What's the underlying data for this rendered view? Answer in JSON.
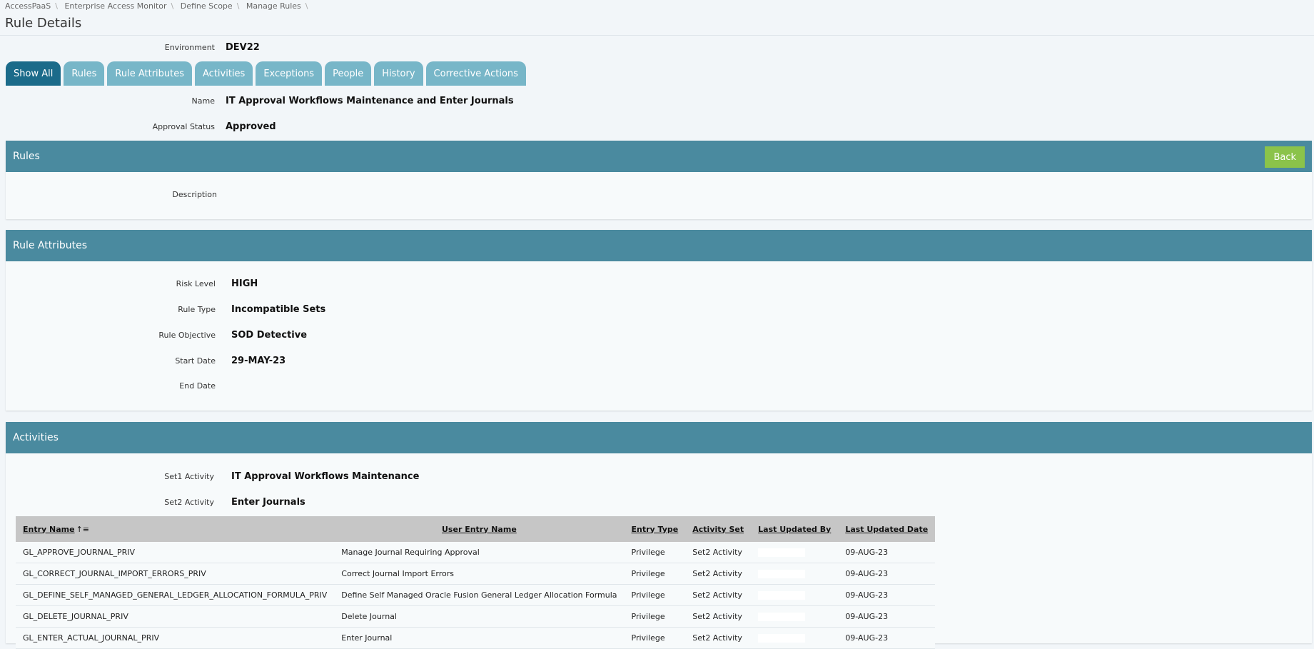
{
  "breadcrumb": [
    "AccessPaaS",
    "Enterprise Access Monitor",
    "Define Scope",
    "Manage Rules"
  ],
  "page_title": "Rule Details",
  "environment": {
    "label": "Environment",
    "value": "DEV22"
  },
  "tabs": [
    "Show All",
    "Rules",
    "Rule Attributes",
    "Activities",
    "Exceptions",
    "People",
    "History",
    "Corrective Actions"
  ],
  "active_tab": "Show All",
  "name": {
    "label": "Name",
    "value": "IT Approval Workflows Maintenance and Enter Journals"
  },
  "approval_status": {
    "label": "Approval Status",
    "value": "Approved"
  },
  "rules_section": {
    "title": "Rules",
    "back_label": "Back",
    "description_label": "Description",
    "description_value": ""
  },
  "rule_attributes_section": {
    "title": "Rule Attributes",
    "fields": [
      {
        "label": "Risk Level",
        "value": "HIGH"
      },
      {
        "label": "Rule Type",
        "value": "Incompatible Sets"
      },
      {
        "label": "Rule Objective",
        "value": "SOD Detective"
      },
      {
        "label": "Start Date",
        "value": "29-MAY-23"
      },
      {
        "label": "End Date",
        "value": ""
      }
    ]
  },
  "activities_section": {
    "title": "Activities",
    "set1": {
      "label": "Set1 Activity",
      "value": "IT Approval Workflows Maintenance"
    },
    "set2": {
      "label": "Set2 Activity",
      "value": "Enter Journals"
    }
  },
  "table": {
    "columns": [
      "Entry Name",
      "User Entry Name",
      "Entry Type",
      "Activity Set",
      "Last Updated By",
      "Last Updated Date"
    ],
    "rows": [
      [
        "GL_APPROVE_JOURNAL_PRIV",
        "Manage Journal Requiring Approval",
        "Privilege",
        "Set2 Activity",
        "",
        "09-AUG-23"
      ],
      [
        "GL_CORRECT_JOURNAL_IMPORT_ERRORS_PRIV",
        "Correct Journal Import Errors",
        "Privilege",
        "Set2 Activity",
        "",
        "09-AUG-23"
      ],
      [
        "GL_DEFINE_SELF_MANAGED_GENERAL_LEDGER_ALLOCATION_FORMULA_PRIV",
        "Define Self Managed Oracle Fusion General Ledger Allocation Formula",
        "Privilege",
        "Set2 Activity",
        "",
        "09-AUG-23"
      ],
      [
        "GL_DELETE_JOURNAL_PRIV",
        "Delete Journal",
        "Privilege",
        "Set2 Activity",
        "",
        "09-AUG-23"
      ],
      [
        "GL_ENTER_ACTUAL_JOURNAL_PRIV",
        "Enter Journal",
        "Privilege",
        "Set2 Activity",
        "",
        "09-AUG-23"
      ]
    ]
  },
  "colors": {
    "header": "#4a8a9f",
    "tab": "#77b6c8",
    "tab_active": "#1b6b8a",
    "back": "#8bc34a",
    "table_header": "#c6c6c6"
  }
}
